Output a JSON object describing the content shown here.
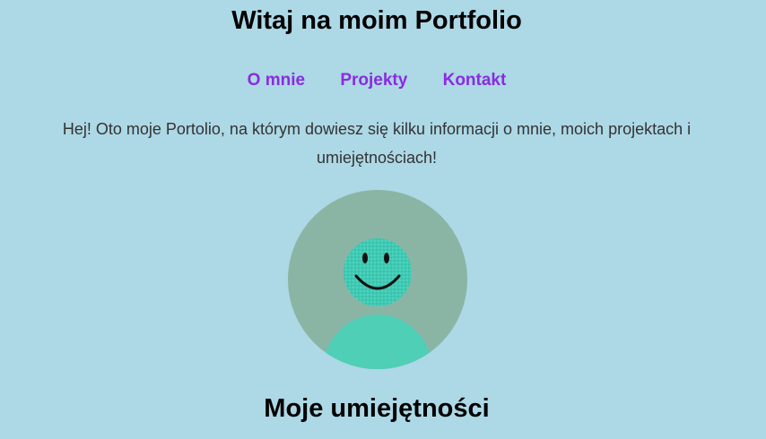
{
  "header": {
    "title": "Witaj na moim Portfolio"
  },
  "nav": {
    "items": [
      {
        "label": "O mnie"
      },
      {
        "label": "Projekty"
      },
      {
        "label": "Kontakt"
      }
    ]
  },
  "intro": {
    "text": "Hej! Oto moje Portolio, na którym dowiesz się kilku informacji o mnie, moich projektach i umiejętnościach!"
  },
  "avatar": {
    "icon": "smiley-avatar-icon"
  },
  "skills": {
    "title": "Moje umiejętności"
  },
  "colors": {
    "background": "#add8e6",
    "link": "#8a2be2",
    "avatar_bg": "#8ab5a4",
    "avatar_accent": "#4ecfb6"
  }
}
